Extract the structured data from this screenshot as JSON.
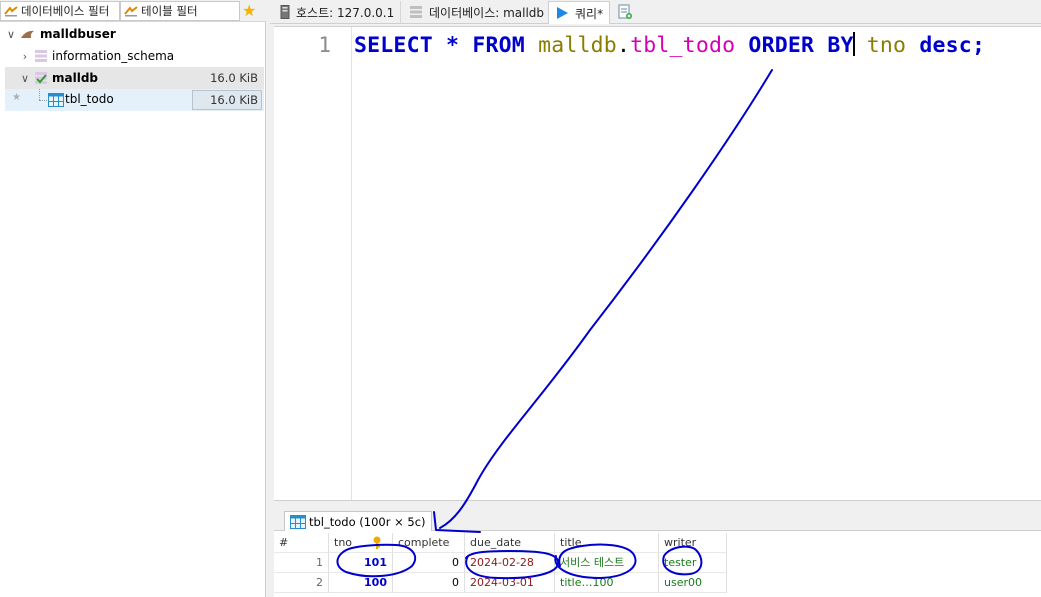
{
  "filters": {
    "database_filter_placeholder": "데이터베이스 필터",
    "table_filter_placeholder": "테이블 필터"
  },
  "tree": {
    "session": "malldbuser",
    "items": [
      {
        "label": "information_schema",
        "size": ""
      },
      {
        "label": "malldb",
        "size": "16.0 KiB"
      },
      {
        "label": "tbl_todo",
        "size": "16.0 KiB"
      }
    ]
  },
  "tabs": [
    {
      "label": "호스트: 127.0.0.1",
      "icon": "host-icon"
    },
    {
      "label": "데이터베이스: malldb",
      "icon": "database-icon"
    },
    {
      "label": "쿼리*",
      "icon": "play-icon"
    }
  ],
  "editor": {
    "line_number": "1",
    "tokens": {
      "select": "SELECT",
      "star": "*",
      "from": "FROM",
      "db": "malldb",
      "dot": ".",
      "table": "tbl_todo",
      "order": "ORDER",
      "by": "BY",
      "column": "tno",
      "desc": "desc",
      "semi": ";"
    }
  },
  "result_tab": {
    "label": "tbl_todo (100r × 5c)"
  },
  "grid": {
    "columns": [
      "#",
      "tno",
      "complete",
      "due_date",
      "title",
      "writer"
    ],
    "rows": [
      {
        "n": "1",
        "tno": "101",
        "complete": "0",
        "due_date": "2024-02-28",
        "title": "서비스 테스트",
        "writer": "tester"
      },
      {
        "n": "2",
        "tno": "100",
        "complete": "0",
        "due_date": "2024-03-01",
        "title": "title…100",
        "writer": "user00"
      }
    ]
  },
  "colors": {
    "keyword": "#0000cc",
    "database_name": "#8a7d00",
    "table_name": "#d400b8",
    "annotation_ink": "#0000cc"
  }
}
